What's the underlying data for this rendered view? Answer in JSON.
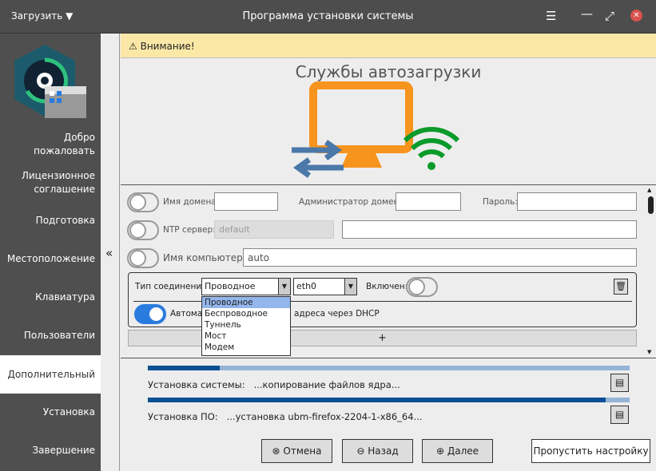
{
  "titlebar": {
    "menu_label": "Загрузить",
    "title": "Программа установки системы"
  },
  "sidebar": {
    "items": [
      {
        "label": "Добро пожаловать"
      },
      {
        "label": "Лицензионное соглашение"
      },
      {
        "label": "Подготовка"
      },
      {
        "label": "Местоположение"
      },
      {
        "label": "Клавиатура"
      },
      {
        "label": "Пользователи"
      },
      {
        "label": "Дополнительный"
      },
      {
        "label": "Установка"
      },
      {
        "label": "Завершение"
      }
    ],
    "active": "Дополнительный",
    "collapse_label": "«"
  },
  "warning": "Внимание!",
  "heading": "Службы автозагрузки",
  "form": {
    "domain_name_label": "Имя домена:",
    "domain_name_value": "",
    "domain_admin_label": "Администратор домена:",
    "domain_admin_value": "",
    "password_label": "Пароль:",
    "password_value": "",
    "ntp_label": "NTP сервер:",
    "ntp_value": "default",
    "ntp_extra_value": "",
    "hostname_label": "Имя компьютера:",
    "hostname_value": "auto",
    "connection": {
      "type_label": "Тип соединения:",
      "type_value": "Проводное",
      "iface_value": "eth0",
      "enabled_label": "Включен:",
      "dhcp_label": "Автоматическое получение адреса через DHCP",
      "dhcp_label_visible": "Автомат",
      "dhcp_label_tail": "адреса через DHCP"
    },
    "type_options": [
      "Проводное",
      "Беспроводное",
      "Туннель",
      "Мост",
      "Модем"
    ],
    "add_label": "+"
  },
  "progress": {
    "system": {
      "label": "Установка системы:",
      "status": "...копирование файлов ядра...",
      "percent": 15
    },
    "software": {
      "label": "Установка ПО:",
      "status": "...установка ubm-firefox-2204-1-x86_64...",
      "percent": 95
    }
  },
  "buttons": {
    "cancel": "Отмена",
    "back": "Назад",
    "next": "Далее",
    "skip": "Пропустить настройку"
  }
}
